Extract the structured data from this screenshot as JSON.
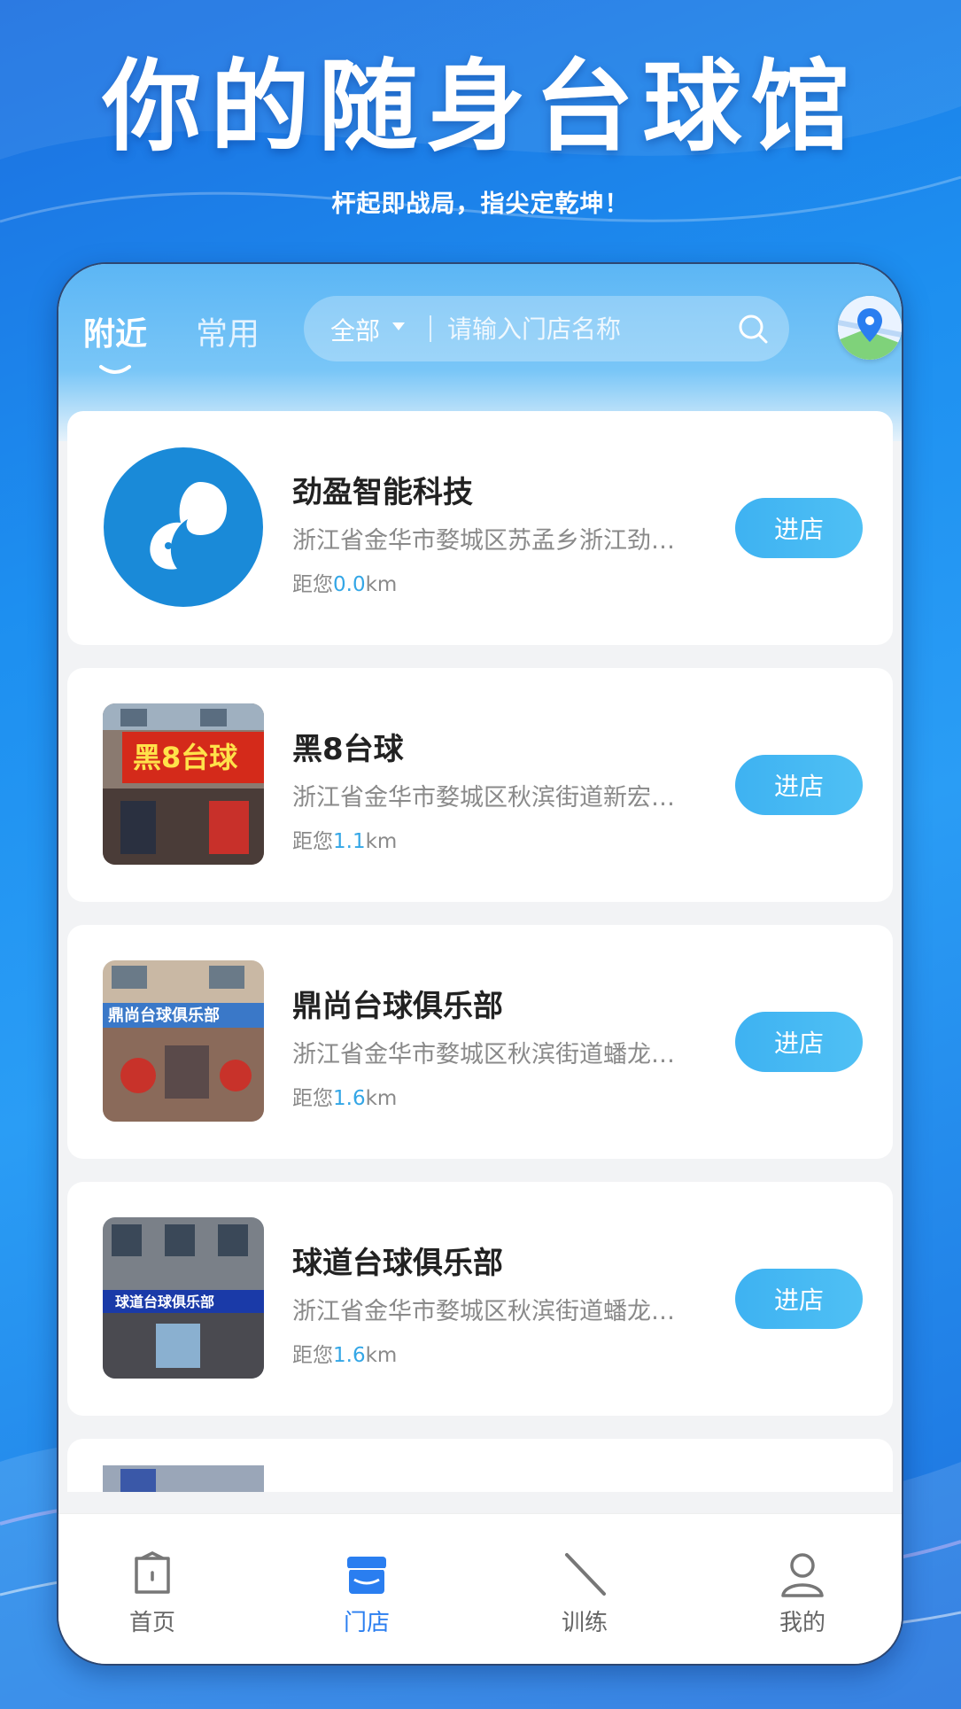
{
  "hero": {
    "title": "你的随身台球馆",
    "subtitle": "杆起即战局，指尖定乾坤！"
  },
  "header": {
    "tabs": [
      {
        "label": "附近",
        "active": true
      },
      {
        "label": "常用",
        "active": false
      }
    ],
    "search": {
      "filter_label": "全部",
      "placeholder": "请输入门店名称"
    }
  },
  "stores": [
    {
      "name": "劲盈智能科技",
      "address": "浙江省金华市婺城区苏孟乡浙江劲…",
      "distance_prefix": "距您",
      "distance": "0.0",
      "unit": "km",
      "button": "进店"
    },
    {
      "name": "黑8台球",
      "address": "浙江省金华市婺城区秋滨街道新宏…",
      "distance_prefix": "距您",
      "distance": "1.1",
      "unit": "km",
      "button": "进店"
    },
    {
      "name": "鼎尚台球俱乐部",
      "address": "浙江省金华市婺城区秋滨街道蟠龙…",
      "distance_prefix": "距您",
      "distance": "1.6",
      "unit": "km",
      "button": "进店"
    },
    {
      "name": "球道台球俱乐部",
      "address": "浙江省金华市婺城区秋滨街道蟠龙…",
      "distance_prefix": "距您",
      "distance": "1.6",
      "unit": "km",
      "button": "进店"
    }
  ],
  "tabbar": [
    {
      "label": "首页",
      "icon": "home-icon",
      "active": false
    },
    {
      "label": "门店",
      "icon": "store-icon",
      "active": true
    },
    {
      "label": "训练",
      "icon": "cue-icon",
      "active": false
    },
    {
      "label": "我的",
      "icon": "profile-icon",
      "active": false
    }
  ],
  "colors": {
    "accent": "#2a7ef0",
    "distance": "#33a6e6",
    "button": "#3eb2f2"
  }
}
